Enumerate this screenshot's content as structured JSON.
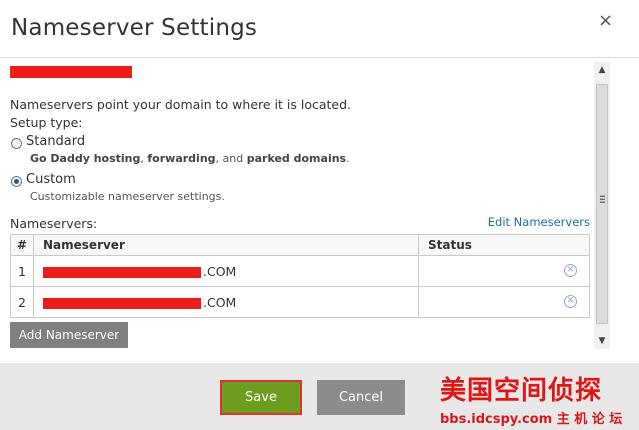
{
  "dialog": {
    "title": "Nameserver Settings",
    "close_glyph": "×",
    "description": "Nameservers point your domain to where it is located.",
    "setup_type_label": "Setup type:",
    "options": [
      {
        "label": "Standard",
        "checked": false,
        "sub": {
          "b1": "Go Daddy hosting",
          "t1": ", ",
          "b2": "forwarding",
          "t2": ", and ",
          "b3": "parked domains",
          "t3": "."
        }
      },
      {
        "label": "Custom",
        "checked": true,
        "sub_text": "Customizable nameserver settings."
      }
    ],
    "nameservers_label": "Nameservers:",
    "edit_link": "Edit Nameservers",
    "table": {
      "headers": [
        "#",
        "Nameserver",
        "Status"
      ],
      "rows": [
        {
          "num": "1",
          "suffix": ".COM",
          "status": ""
        },
        {
          "num": "2",
          "suffix": ".COM",
          "status": ""
        }
      ]
    },
    "add_button": "Add Nameserver",
    "save_button": "Save",
    "cancel_button": "Cancel"
  },
  "watermark": {
    "top": "美国空间侦探",
    "bottom": "bbs.idcspy.com 主 机 论 坛"
  },
  "colors": {
    "save_green": "#6e9c1c",
    "button_gray": "#8c8c8c",
    "link_blue": "#1a6ea8",
    "redaction_red": "#ef1c1c"
  },
  "icons": {
    "close": "close-icon",
    "remove": "remove-circle-icon",
    "scroll_up": "arrow-up-icon",
    "scroll_down": "arrow-down-icon"
  }
}
